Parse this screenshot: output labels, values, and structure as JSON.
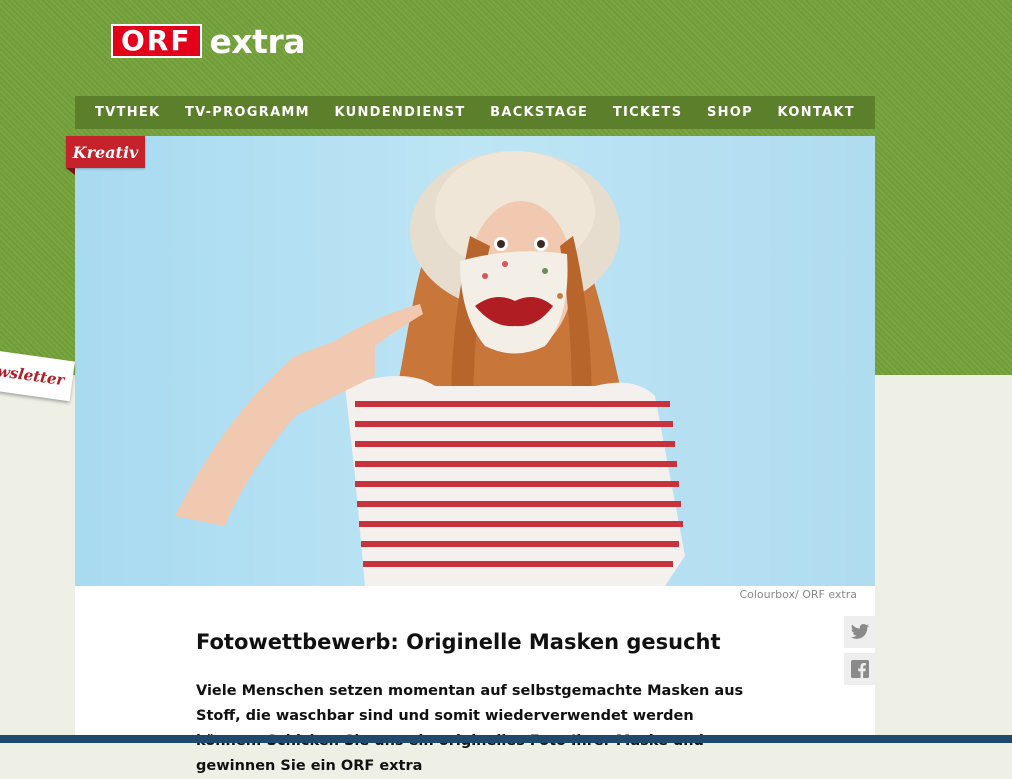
{
  "brand": {
    "orf": "ORF",
    "extra": "extra",
    "orf_color": "#e2001a"
  },
  "nav": {
    "items": [
      "TVTHEK",
      "TV-PROGRAMM",
      "KUNDENDIENST",
      "BACKSTAGE",
      "TICKETS",
      "SHOP",
      "KONTAKT"
    ]
  },
  "article": {
    "tag": "Kreativ",
    "image_credit": "Colourbox/ ORF extra",
    "headline": "Fotowettbewerb: Originelle Masken gesucht",
    "body": "Viele Menschen setzen momentan auf selbstgemachte Masken aus Stoff, die waschbar sind und somit wiederverwendet werden können. Schicken Sie uns ein originelles Foto Ihrer Maske und gewinnen Sie ein ORF extra"
  },
  "newsletter": {
    "label": "Newsletter"
  },
  "social": {
    "icons": [
      "twitter-icon",
      "facebook-icon"
    ]
  },
  "colors": {
    "background_green": "#74a23a",
    "nav_green": "#5b7f2b",
    "tag_red": "#c5222b"
  }
}
